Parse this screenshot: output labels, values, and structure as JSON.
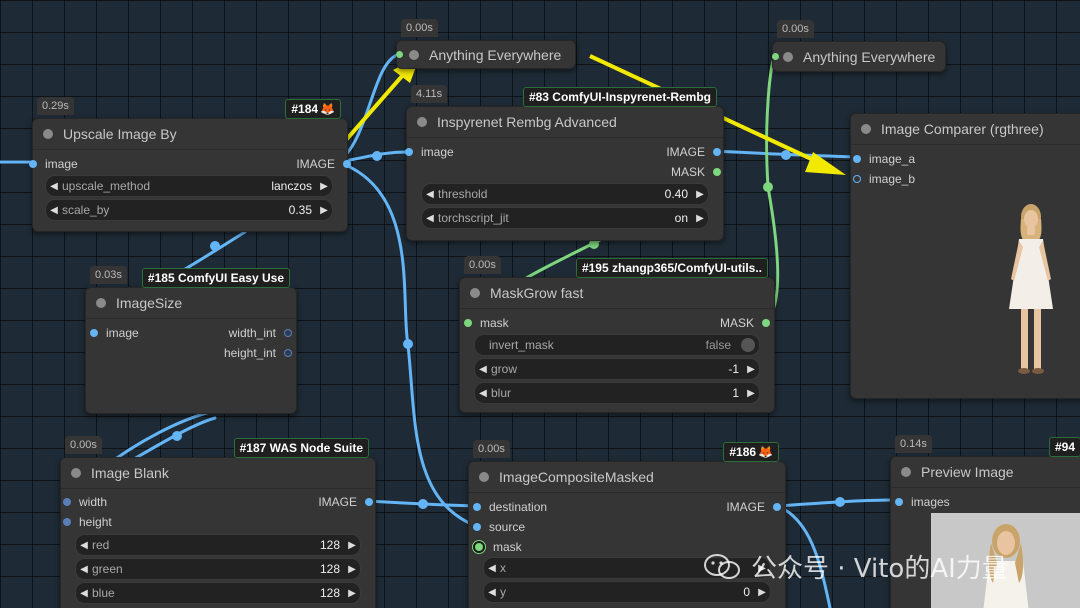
{
  "colors": {
    "image_wire": "#64b5f6",
    "mask_wire": "#7ed67e",
    "arrow": "#f2e900",
    "canvas": "#1e2a35",
    "node": "#353535"
  },
  "nodes": {
    "anything1": {
      "timing": "0.00s",
      "title": "Anything Everywhere"
    },
    "anything2": {
      "timing": "0.00s",
      "title": "Anything Everywhere"
    },
    "upscale": {
      "timing": "0.29s",
      "badge": "#184",
      "title": "Upscale Image By",
      "in_image": "image",
      "out_image": "IMAGE",
      "w1_label": "upscale_method",
      "w1_value": "lanczos",
      "w2_label": "scale_by",
      "w2_value": "0.35"
    },
    "rembg": {
      "timing": "4.11s",
      "badge": "#83 ComfyUI-Inspyrenet-Rembg",
      "title": "Inspyrenet Rembg Advanced",
      "in_image": "image",
      "out_image": "IMAGE",
      "out_mask": "MASK",
      "w1_label": "threshold",
      "w1_value": "0.40",
      "w2_label": "torchscript_jit",
      "w2_value": "on"
    },
    "comparer": {
      "title": "Image Comparer (rgthree)",
      "in_a": "image_a",
      "in_b": "image_b"
    },
    "imagesize": {
      "timing": "0.03s",
      "badge": "#185 ComfyUI Easy Use",
      "title": "ImageSize",
      "in_image": "image",
      "out_w": "width_int",
      "out_h": "height_int"
    },
    "maskgrow": {
      "timing": "0.00s",
      "badge": "#195 zhangp365/ComfyUI-utils..",
      "title": "MaskGrow fast",
      "in_mask": "mask",
      "out_mask": "MASK",
      "w1_label": "invert_mask",
      "w1_value": "false",
      "w2_label": "grow",
      "w2_value": "-1",
      "w3_label": "blur",
      "w3_value": "1"
    },
    "blank": {
      "timing": "0.00s",
      "badge": "#187 WAS Node Suite",
      "title": "Image Blank",
      "in_w": "width",
      "in_h": "height",
      "out_image": "IMAGE",
      "w1_label": "red",
      "w1_value": "128",
      "w2_label": "green",
      "w2_value": "128",
      "w3_label": "blue",
      "w3_value": "128"
    },
    "composite": {
      "timing": "0.00s",
      "badge": "#186",
      "title": "ImageCompositeMasked",
      "in_dest": "destination",
      "in_src": "source",
      "in_mask": "mask",
      "out_image": "IMAGE",
      "w1_label": "x",
      "w1_value": "",
      "w2_label": "y",
      "w2_value": "0"
    },
    "preview": {
      "timing": "0.14s",
      "badge": "#94",
      "title": "Preview Image",
      "in_images": "images"
    }
  },
  "watermark": {
    "text": "公众号 · Vito的AI力量"
  }
}
